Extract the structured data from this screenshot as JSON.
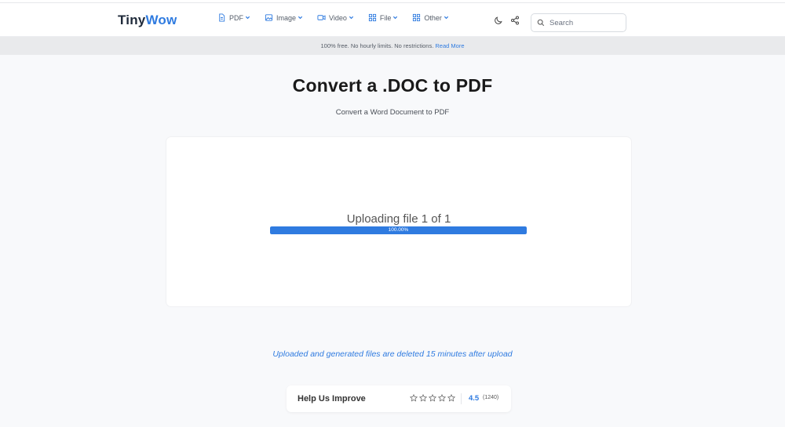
{
  "header": {
    "logo_part1": "Tiny",
    "logo_part2": "Wow",
    "nav": [
      {
        "label": "PDF",
        "icon": "document-icon"
      },
      {
        "label": "Image",
        "icon": "image-icon"
      },
      {
        "label": "Video",
        "icon": "video-icon"
      },
      {
        "label": "File",
        "icon": "grid-icon"
      },
      {
        "label": "Other",
        "icon": "grid-icon"
      }
    ],
    "search_placeholder": "Search"
  },
  "banner": {
    "text": "100% free. No hourly limits. No restrictions.",
    "link": "Read More"
  },
  "main": {
    "title": "Convert a .DOC to PDF",
    "subtitle": "Convert a Word Document to PDF"
  },
  "upload": {
    "status": "Uploading file 1 of 1",
    "progress_percent": 100,
    "progress_text": "100.00%"
  },
  "notice": "Uploaded and generated files are deleted 15 minutes after upload",
  "rating": {
    "title": "Help Us Improve",
    "score": "4.5",
    "count": "(1240)"
  },
  "colors": {
    "accent": "#2f7be0",
    "background": "#f8f9fb",
    "banner": "#e9eaec"
  }
}
